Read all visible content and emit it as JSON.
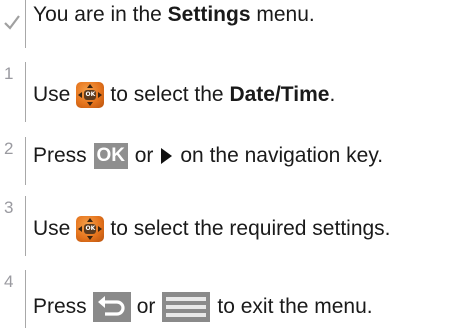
{
  "precondition": {
    "icon": "checkmark-icon",
    "text_before": "You are in the ",
    "bold": "Settings",
    "text_after": " menu."
  },
  "steps": [
    {
      "number": "1",
      "text_before": "Use",
      "icon": "navigation-key-icon",
      "text_middle": "to select the ",
      "bold": "Date/Time",
      "text_after": "."
    },
    {
      "number": "2",
      "text_before": "Press",
      "key_label": "OK",
      "text_middle": "or",
      "icon": "right-arrow-icon",
      "text_after": "on the navigation key."
    },
    {
      "number": "3",
      "text_before": "Use",
      "icon": "navigation-key-icon",
      "text_after": "to select the required settings."
    },
    {
      "number": "4",
      "text_before": "Press",
      "icon_1": "back-key-icon",
      "text_middle": "or",
      "icon_2": "menu-key-icon",
      "text_after": "to exit the menu."
    }
  ],
  "colors": {
    "nav_key": "#e5741d",
    "key_grey": "#8f8f8f",
    "step_number": "#9a9aa0"
  }
}
